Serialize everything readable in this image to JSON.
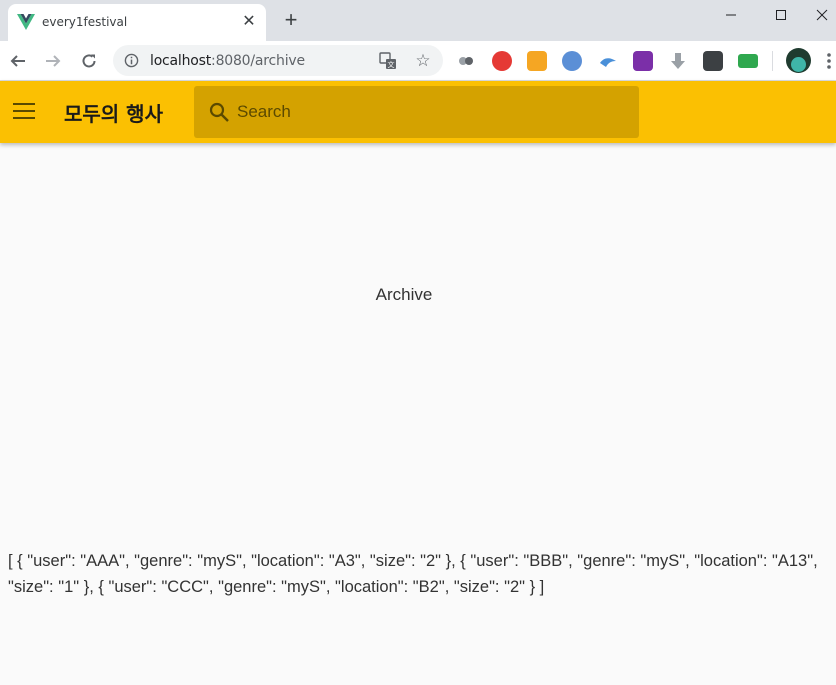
{
  "browser": {
    "tab_title": "every1festival",
    "tab_close": "✕",
    "new_tab": "+",
    "url_host": "localhost",
    "url_path": ":8080/archive",
    "window_controls": {
      "minimize": "minimize-icon",
      "maximize": "maximize-icon",
      "close": "close-icon"
    }
  },
  "appbar": {
    "title": "모두의 행사",
    "search_placeholder": "Search",
    "color": "#fbc002"
  },
  "main": {
    "heading": "Archive",
    "json_text": "[ { \"user\": \"AAA\", \"genre\": \"myS\", \"location\": \"A3\", \"size\": \"2\" }, { \"user\": \"BBB\", \"genre\": \"myS\", \"location\": \"A13\", \"size\": \"1\" }, { \"user\": \"CCC\", \"genre\": \"myS\", \"location\": \"B2\", \"size\": \"2\" } ]"
  }
}
